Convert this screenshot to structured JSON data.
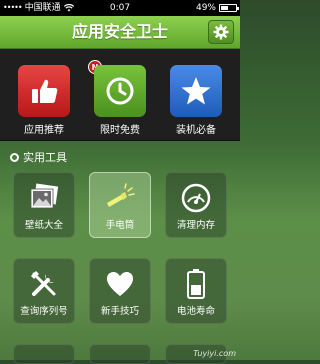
{
  "status_bar": {
    "signal": "•••••",
    "carrier": "中国联通",
    "time": "0:07",
    "battery_percent": "49%",
    "battery_level": 0.49
  },
  "header": {
    "title": "应用安全卫士",
    "settings_icon": "gear-icon"
  },
  "featured": [
    {
      "label": "应用推荐",
      "icon": "thumbs-up-icon",
      "color": "#d62a2a",
      "badge": "N"
    },
    {
      "label": "限时免费",
      "icon": "clock-icon",
      "color": "#5aa52a"
    },
    {
      "label": "装机必备",
      "icon": "star-icon",
      "color": "#2a6fd0"
    }
  ],
  "tools_section": {
    "title": "实用工具",
    "items": [
      {
        "label": "壁纸大全",
        "icon": "picture-icon"
      },
      {
        "label": "手电筒",
        "icon": "flashlight-icon",
        "active": true
      },
      {
        "label": "清理内存",
        "icon": "gauge-icon"
      },
      {
        "label": "查询序列号",
        "icon": "tools-icon"
      },
      {
        "label": "新手技巧",
        "icon": "heart-icon"
      },
      {
        "label": "电池寿命",
        "icon": "battery-icon"
      }
    ]
  },
  "watermark": "Tuyiyi.com"
}
